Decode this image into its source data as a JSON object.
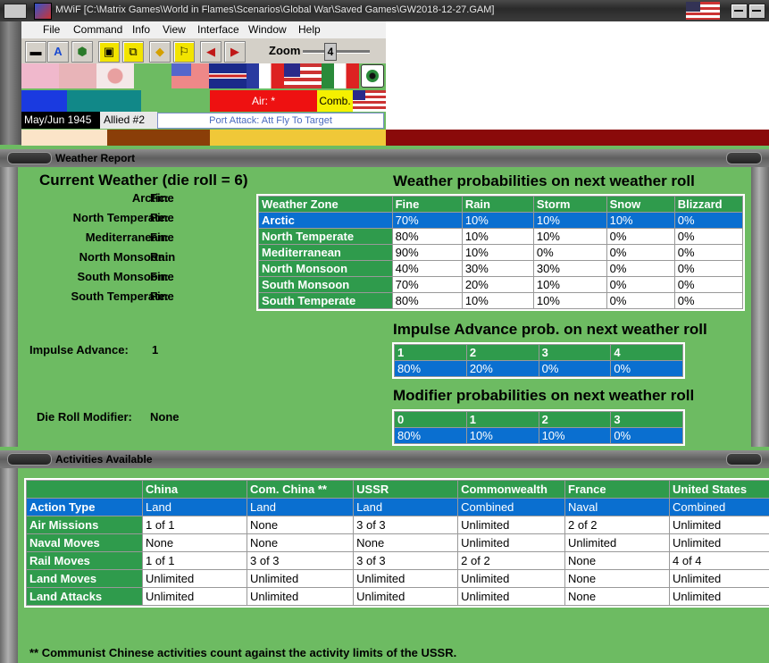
{
  "window": {
    "title": "MWiF [C:\\Matrix Games\\World in Flames\\Scenarios\\Global War\\Saved Games\\GW2018-12-27.GAM]"
  },
  "menu": [
    "File",
    "Command",
    "Info",
    "View",
    "Interface",
    "Window",
    "Help"
  ],
  "toolbar": {
    "zoom_label": "Zoom",
    "zoom_value": "4"
  },
  "status": {
    "date": "May/Jun 1945",
    "side": "Allied #2",
    "phase": "Port Attack: Att Fly To Target",
    "air_label": "Air: *",
    "comb_label": "Comb."
  },
  "weather_panel": {
    "title": "Weather Report",
    "current_title": "Current Weather (die roll = 6)",
    "current": [
      {
        "zone": "Arctic:",
        "weather": "Fine"
      },
      {
        "zone": "North Temperate:",
        "weather": "Fine"
      },
      {
        "zone": "Mediterranean:",
        "weather": "Fine"
      },
      {
        "zone": "North Monsoon:",
        "weather": "Rain"
      },
      {
        "zone": "South Monsoon:",
        "weather": "Fine"
      },
      {
        "zone": "South Temperate:",
        "weather": "Fine"
      }
    ],
    "impulse_label": "Impulse Advance:",
    "impulse_value": "1",
    "modifier_label": "Die Roll Modifier:",
    "modifier_value": "None",
    "prob_title": "Weather probabilities on next weather roll",
    "prob_headers": [
      "Weather Zone",
      "Fine",
      "Rain",
      "Storm",
      "Snow",
      "Blizzard"
    ],
    "prob_rows": [
      [
        "Arctic",
        "70%",
        "10%",
        "10%",
        "10%",
        "0%"
      ],
      [
        "North Temperate",
        "80%",
        "10%",
        "10%",
        "0%",
        "0%"
      ],
      [
        "Mediterranean",
        "90%",
        "10%",
        "0%",
        "0%",
        "0%"
      ],
      [
        "North Monsoon",
        "40%",
        "30%",
        "30%",
        "0%",
        "0%"
      ],
      [
        "South Monsoon",
        "70%",
        "20%",
        "10%",
        "0%",
        "0%"
      ],
      [
        "South Temperate",
        "80%",
        "10%",
        "10%",
        "0%",
        "0%"
      ]
    ],
    "impulse_title": "Impulse Advance prob. on next weather roll",
    "impulse_headers": [
      "1",
      "2",
      "3",
      "4"
    ],
    "impulse_values": [
      "80%",
      "20%",
      "0%",
      "0%"
    ],
    "mod_title": "Modifier probabilities on next weather roll",
    "mod_headers": [
      "0",
      "1",
      "2",
      "3"
    ],
    "mod_values": [
      "80%",
      "10%",
      "10%",
      "0%"
    ]
  },
  "activities_panel": {
    "title": "Activities Available",
    "headers": [
      "",
      "China",
      "Com. China **",
      "USSR",
      "Commonwealth",
      "France",
      "United States"
    ],
    "rows": [
      [
        "Action Type",
        "Land",
        "Land",
        "Land",
        "Combined",
        "Naval",
        "Combined"
      ],
      [
        "Air Missions",
        "1 of 1",
        "None",
        "3 of 3",
        "Unlimited",
        "2 of 2",
        "Unlimited"
      ],
      [
        "Naval Moves",
        "None",
        "None",
        "None",
        "Unlimited",
        "Unlimited",
        "Unlimited"
      ],
      [
        "Rail Moves",
        "1 of 1",
        "3 of 3",
        "3 of 3",
        "2 of 2",
        "None",
        "4 of 4"
      ],
      [
        "Land Moves",
        "Unlimited",
        "Unlimited",
        "Unlimited",
        "Unlimited",
        "None",
        "Unlimited"
      ],
      [
        "Land Attacks",
        "Unlimited",
        "Unlimited",
        "Unlimited",
        "Unlimited",
        "None",
        "Unlimited"
      ]
    ],
    "footnote": "** Communist Chinese activities count against the activity limits of the USSR."
  },
  "colors": {
    "panel_bg": "#6dbb62",
    "header_green": "#2f9b4c",
    "selected_blue": "#0a6fd0"
  }
}
